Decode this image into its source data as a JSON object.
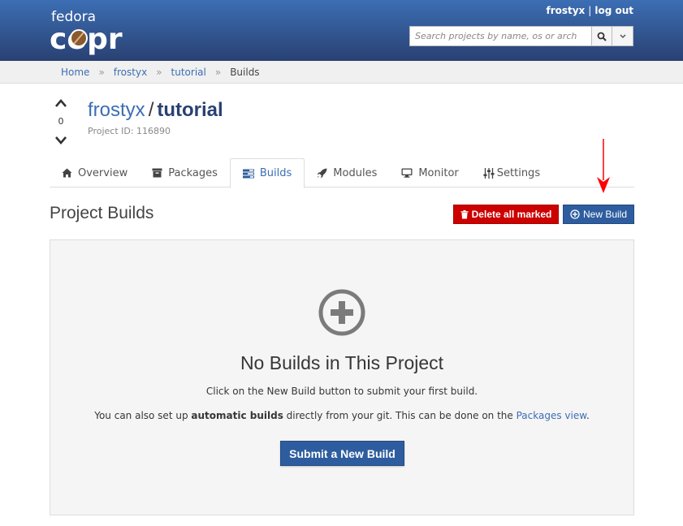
{
  "header": {
    "logo_top": "fedora",
    "logo_bottom": "copr",
    "user": "frostyx",
    "separator": "|",
    "logout": "log out",
    "search_placeholder": "Search projects by name, os or arch"
  },
  "breadcrumb": [
    "Home",
    "frostyx",
    "tutorial",
    "Builds"
  ],
  "vote": {
    "count": "0"
  },
  "project": {
    "owner": "frostyx",
    "slash": "/",
    "name": "tutorial",
    "id_label": "Project ID: 116890"
  },
  "tabs": [
    {
      "label": "Overview",
      "icon": "home-icon"
    },
    {
      "label": "Packages",
      "icon": "archive-icon"
    },
    {
      "label": "Builds",
      "icon": "tasks-icon",
      "active": true
    },
    {
      "label": "Modules",
      "icon": "rocket-icon"
    },
    {
      "label": "Monitor",
      "icon": "desktop-icon"
    },
    {
      "label": "Settings",
      "icon": "sliders-icon"
    }
  ],
  "section": {
    "title": "Project Builds",
    "delete_label": "Delete all marked",
    "new_build_label": "New Build"
  },
  "empty": {
    "title": "No Builds in This Project",
    "line1": "Click on the New Build button to submit your first build.",
    "line2_pre": "You can also set up ",
    "line2_bold": "automatic builds",
    "line2_mid": " directly from your git. This can be done on the ",
    "line2_link": "Packages view",
    "line2_post": ".",
    "submit_label": "Submit a New Build"
  },
  "colors": {
    "header": "#294172",
    "link": "#3c6eb4",
    "danger": "#cc0000",
    "primary": "#2e5d9f",
    "annotation": "#ff0000"
  }
}
